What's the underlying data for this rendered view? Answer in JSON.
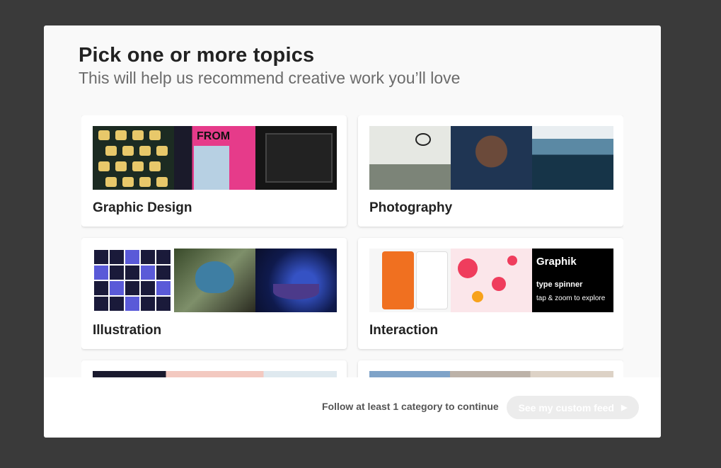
{
  "header": {
    "title": "Pick one or more topics",
    "subtitle": "This will help us recommend creative work you’ll love"
  },
  "topics": [
    {
      "label": "Graphic Design"
    },
    {
      "label": "Photography"
    },
    {
      "label": "Illustration"
    },
    {
      "label": "Interaction"
    },
    {
      "label": ""
    },
    {
      "label": ""
    }
  ],
  "thumb_text": {
    "graphic_design_poster": "FROM",
    "interaction_type_title": "Graphik",
    "interaction_type_sub": "type spinner",
    "interaction_type_hint": "tap & zoom to explore"
  },
  "footer": {
    "hint": "Follow at least 1 category to continue",
    "cta_label": "See my custom feed"
  },
  "colors": {
    "background": "#3a3a3a",
    "modal": "#f9f9f9",
    "cta_disabled": "#ececec"
  }
}
